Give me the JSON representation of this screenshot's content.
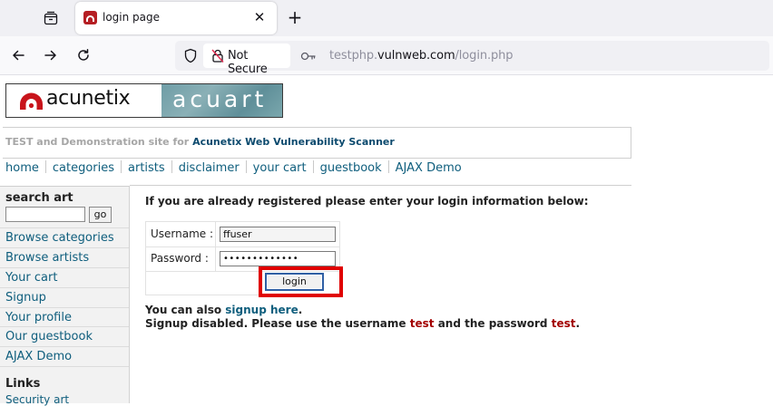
{
  "browser": {
    "tab_title": "login page",
    "tab_close": "✕",
    "new_tab": "+",
    "not_secure": "Not Secure",
    "url_scheme_part": "testphp.",
    "url_host": "vulnweb.com",
    "url_path": "/login.php"
  },
  "header": {
    "logo_text": "acunetix",
    "logo_art_text": "acuart",
    "tagline_prefix": "TEST and Demonstration site for",
    "tagline_product": "Acunetix Web Vulnerability Scanner"
  },
  "topnav": {
    "items": [
      "home",
      "categories",
      "artists",
      "disclaimer",
      "your cart",
      "guestbook",
      "AJAX Demo"
    ]
  },
  "sidebar": {
    "search_title": "search art",
    "search_value": "",
    "go_label": "go",
    "items": [
      "Browse categories",
      "Browse artists",
      "Your cart",
      "Signup",
      "Your profile",
      "Our guestbook",
      "AJAX Demo"
    ],
    "links_title": "Links",
    "links_sub": "Security art"
  },
  "login": {
    "intro": "If you are already registered please enter your login information below:",
    "username_label": "Username :",
    "password_label": "Password :",
    "username_value": "ffuser",
    "password_value": "•••••••••••••",
    "button_label": "login",
    "also_prefix": "You can also",
    "also_link": "signup here",
    "also_suffix": ".",
    "disabled_prefix": "Signup disabled. Please use the username",
    "disabled_user": "test",
    "disabled_mid": "and the password",
    "disabled_pass": "test",
    "disabled_suffix": "."
  },
  "colors": {
    "highlight": "#e00000",
    "link": "#0f5e7d",
    "brand_red": "#b51e23"
  }
}
